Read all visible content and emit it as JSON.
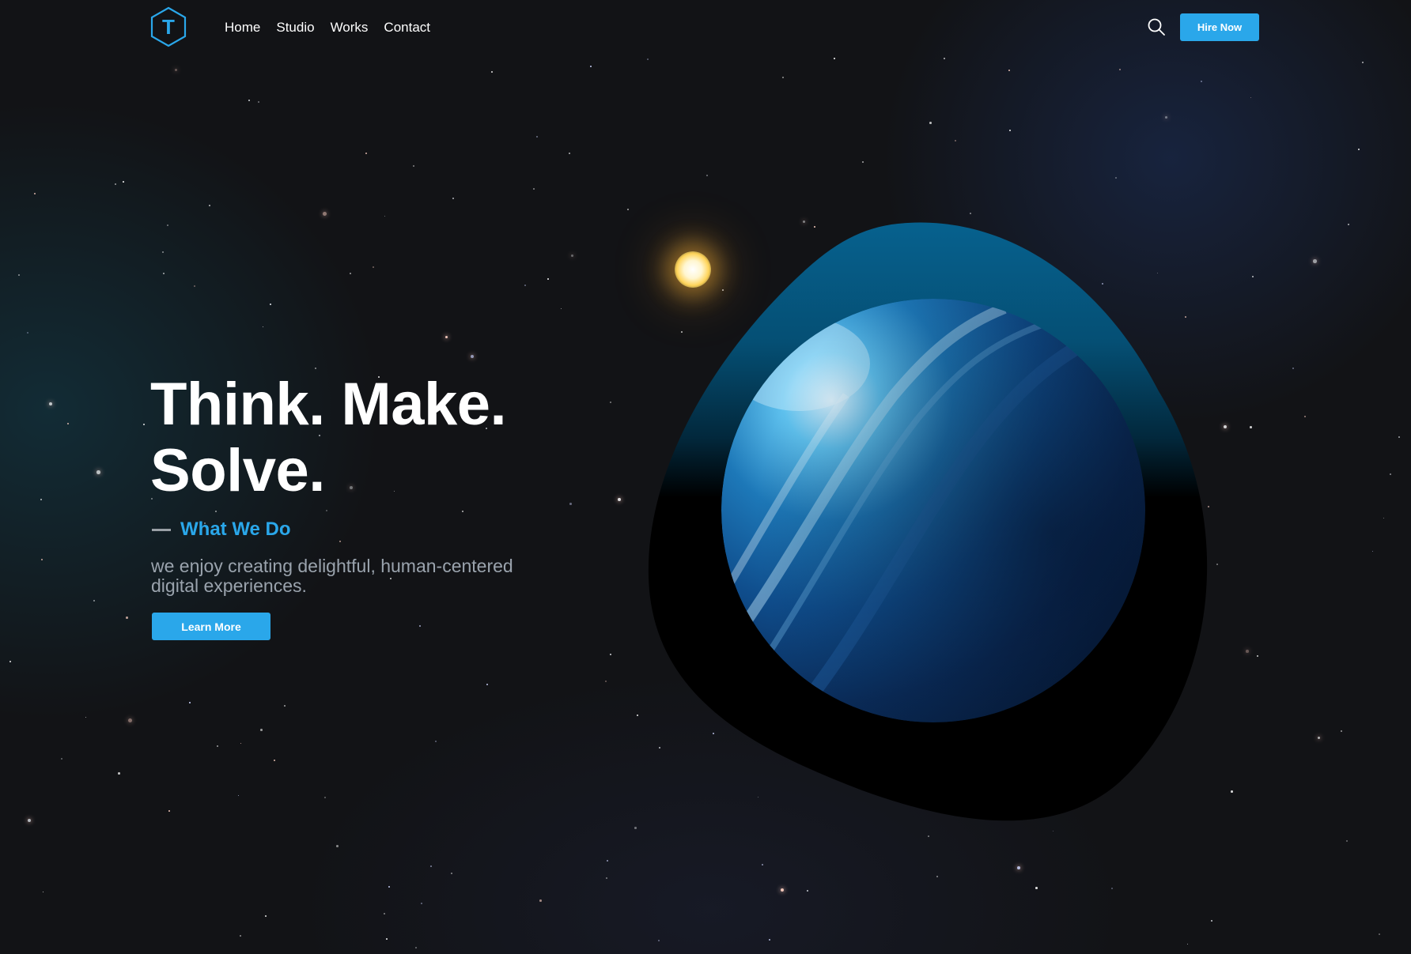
{
  "header": {
    "logo_letter": "T",
    "nav": [
      "Home",
      "Studio",
      "Works",
      "Contact"
    ],
    "hire_label": "Hire Now"
  },
  "hero": {
    "title_line1": "Think. Make.",
    "title_line2": "Solve.",
    "subheading": "What We Do",
    "description": "we enjoy creating delightful, human-centered digital experiences.",
    "cta_label": "Learn More"
  },
  "icons": {
    "logo": "hexagon-logo-icon",
    "search": "search-icon",
    "sun": "sun-icon",
    "planet": "planet-icon"
  },
  "colors": {
    "accent": "#2aa7ea",
    "background": "#121316",
    "blob": "#065f8a"
  }
}
